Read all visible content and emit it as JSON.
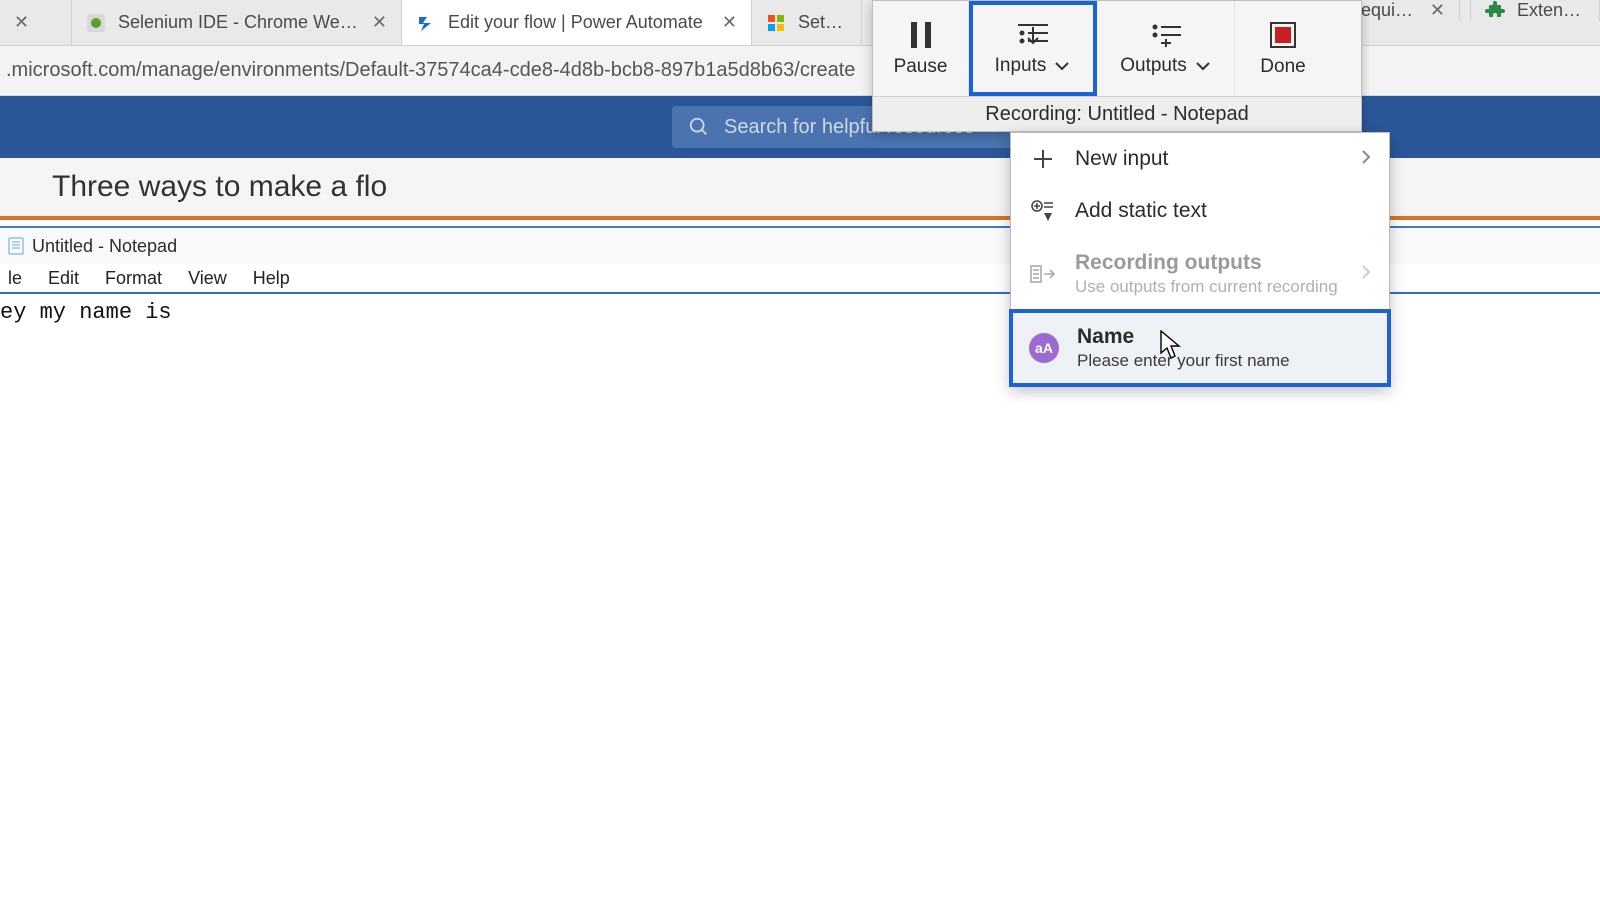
{
  "tabs": [
    {
      "title": "",
      "favicon": "blank"
    },
    {
      "title": "Selenium IDE - Chrome Web Stor",
      "favicon": "selenium"
    },
    {
      "title": "Edit your flow | Power Automate",
      "favicon": "flow",
      "active": true
    },
    {
      "title": "Set up",
      "favicon": "microsoft"
    },
    {
      "title": "requiren",
      "favicon": "blank"
    },
    {
      "title": "Extensions",
      "favicon": "extension"
    }
  ],
  "address_bar": ".microsoft.com/manage/environments/Default-37574ca4-cde8-4d8b-bcb8-897b1a5d8b63/create",
  "pa": {
    "search_placeholder": "Search for helpful resources",
    "headline": "Three ways to make a flo"
  },
  "notepad": {
    "title": "Untitled - Notepad",
    "menus": [
      "le",
      "Edit",
      "Format",
      "View",
      "Help"
    ],
    "content": "ey my name is"
  },
  "rec": {
    "pause": "Pause",
    "inputs": "Inputs",
    "outputs": "Outputs",
    "done": "Done",
    "status": "Recording: Untitled - Notepad"
  },
  "inputs_menu": {
    "new_input": "New input",
    "add_static": "Add static text",
    "rec_outputs_title": "Recording outputs",
    "rec_outputs_sub": "Use outputs from current recording",
    "name_title": "Name",
    "name_sub": "Please enter your first name"
  }
}
